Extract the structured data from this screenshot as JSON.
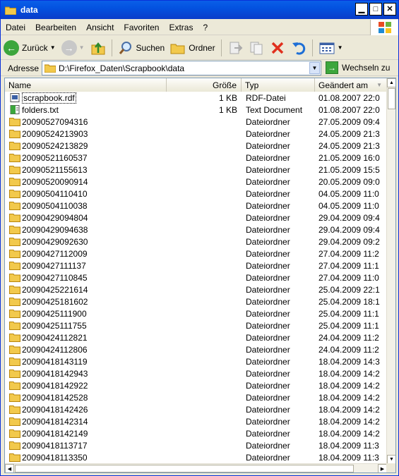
{
  "window": {
    "title": "data"
  },
  "menu": [
    "Datei",
    "Bearbeiten",
    "Ansicht",
    "Favoriten",
    "Extras",
    "?"
  ],
  "toolbar": {
    "back_label": "Zurück",
    "search_label": "Suchen",
    "folders_label": "Ordner"
  },
  "address": {
    "label": "Adresse",
    "path": "D:\\Firefox_Daten\\Scrapbook\\data",
    "go_label": "Wechseln zu"
  },
  "columns": {
    "name": "Name",
    "size": "Größe",
    "type": "Typ",
    "date": "Geändert am"
  },
  "colors": {
    "titlebar": "#0A5FE8",
    "folder": "#F2C94C",
    "accent": "#3CA63C"
  },
  "files": [
    {
      "icon": "rdf-file-icon",
      "name": "scrapbook.rdf",
      "size": "1 KB",
      "type": "RDF-Datei",
      "date": "01.08.2007 22:0"
    },
    {
      "icon": "text-file-icon",
      "name": "folders.txt",
      "size": "1 KB",
      "type": "Text Document",
      "date": "01.08.2007 22:0"
    },
    {
      "icon": "folder-icon",
      "name": "20090527094316",
      "size": "",
      "type": "Dateiordner",
      "date": "27.05.2009 09:4"
    },
    {
      "icon": "folder-icon",
      "name": "20090524213903",
      "size": "",
      "type": "Dateiordner",
      "date": "24.05.2009 21:3"
    },
    {
      "icon": "folder-icon",
      "name": "20090524213829",
      "size": "",
      "type": "Dateiordner",
      "date": "24.05.2009 21:3"
    },
    {
      "icon": "folder-icon",
      "name": "20090521160537",
      "size": "",
      "type": "Dateiordner",
      "date": "21.05.2009 16:0"
    },
    {
      "icon": "folder-icon",
      "name": "20090521155613",
      "size": "",
      "type": "Dateiordner",
      "date": "21.05.2009 15:5"
    },
    {
      "icon": "folder-icon",
      "name": "20090520090914",
      "size": "",
      "type": "Dateiordner",
      "date": "20.05.2009 09:0"
    },
    {
      "icon": "folder-icon",
      "name": "20090504110410",
      "size": "",
      "type": "Dateiordner",
      "date": "04.05.2009 11:0"
    },
    {
      "icon": "folder-icon",
      "name": "20090504110038",
      "size": "",
      "type": "Dateiordner",
      "date": "04.05.2009 11:0"
    },
    {
      "icon": "folder-icon",
      "name": "20090429094804",
      "size": "",
      "type": "Dateiordner",
      "date": "29.04.2009 09:4"
    },
    {
      "icon": "folder-icon",
      "name": "20090429094638",
      "size": "",
      "type": "Dateiordner",
      "date": "29.04.2009 09:4"
    },
    {
      "icon": "folder-icon",
      "name": "20090429092630",
      "size": "",
      "type": "Dateiordner",
      "date": "29.04.2009 09:2"
    },
    {
      "icon": "folder-icon",
      "name": "20090427112009",
      "size": "",
      "type": "Dateiordner",
      "date": "27.04.2009 11:2"
    },
    {
      "icon": "folder-icon",
      "name": "20090427111137",
      "size": "",
      "type": "Dateiordner",
      "date": "27.04.2009 11:1"
    },
    {
      "icon": "folder-icon",
      "name": "20090427110845",
      "size": "",
      "type": "Dateiordner",
      "date": "27.04.2009 11:0"
    },
    {
      "icon": "folder-icon",
      "name": "20090425221614",
      "size": "",
      "type": "Dateiordner",
      "date": "25.04.2009 22:1"
    },
    {
      "icon": "folder-icon",
      "name": "20090425181602",
      "size": "",
      "type": "Dateiordner",
      "date": "25.04.2009 18:1"
    },
    {
      "icon": "folder-icon",
      "name": "20090425111900",
      "size": "",
      "type": "Dateiordner",
      "date": "25.04.2009 11:1"
    },
    {
      "icon": "folder-icon",
      "name": "20090425111755",
      "size": "",
      "type": "Dateiordner",
      "date": "25.04.2009 11:1"
    },
    {
      "icon": "folder-icon",
      "name": "20090424112821",
      "size": "",
      "type": "Dateiordner",
      "date": "24.04.2009 11:2"
    },
    {
      "icon": "folder-icon",
      "name": "20090424112806",
      "size": "",
      "type": "Dateiordner",
      "date": "24.04.2009 11:2"
    },
    {
      "icon": "folder-icon",
      "name": "20090418143119",
      "size": "",
      "type": "Dateiordner",
      "date": "18.04.2009 14:3"
    },
    {
      "icon": "folder-icon",
      "name": "20090418142943",
      "size": "",
      "type": "Dateiordner",
      "date": "18.04.2009 14:2"
    },
    {
      "icon": "folder-icon",
      "name": "20090418142922",
      "size": "",
      "type": "Dateiordner",
      "date": "18.04.2009 14:2"
    },
    {
      "icon": "folder-icon",
      "name": "20090418142528",
      "size": "",
      "type": "Dateiordner",
      "date": "18.04.2009 14:2"
    },
    {
      "icon": "folder-icon",
      "name": "20090418142426",
      "size": "",
      "type": "Dateiordner",
      "date": "18.04.2009 14:2"
    },
    {
      "icon": "folder-icon",
      "name": "20090418142314",
      "size": "",
      "type": "Dateiordner",
      "date": "18.04.2009 14:2"
    },
    {
      "icon": "folder-icon",
      "name": "20090418142149",
      "size": "",
      "type": "Dateiordner",
      "date": "18.04.2009 14:2"
    },
    {
      "icon": "folder-icon",
      "name": "20090418113717",
      "size": "",
      "type": "Dateiordner",
      "date": "18.04.2009 11:3"
    },
    {
      "icon": "folder-icon",
      "name": "20090418113350",
      "size": "",
      "type": "Dateiordner",
      "date": "18.04.2009 11:3"
    }
  ]
}
